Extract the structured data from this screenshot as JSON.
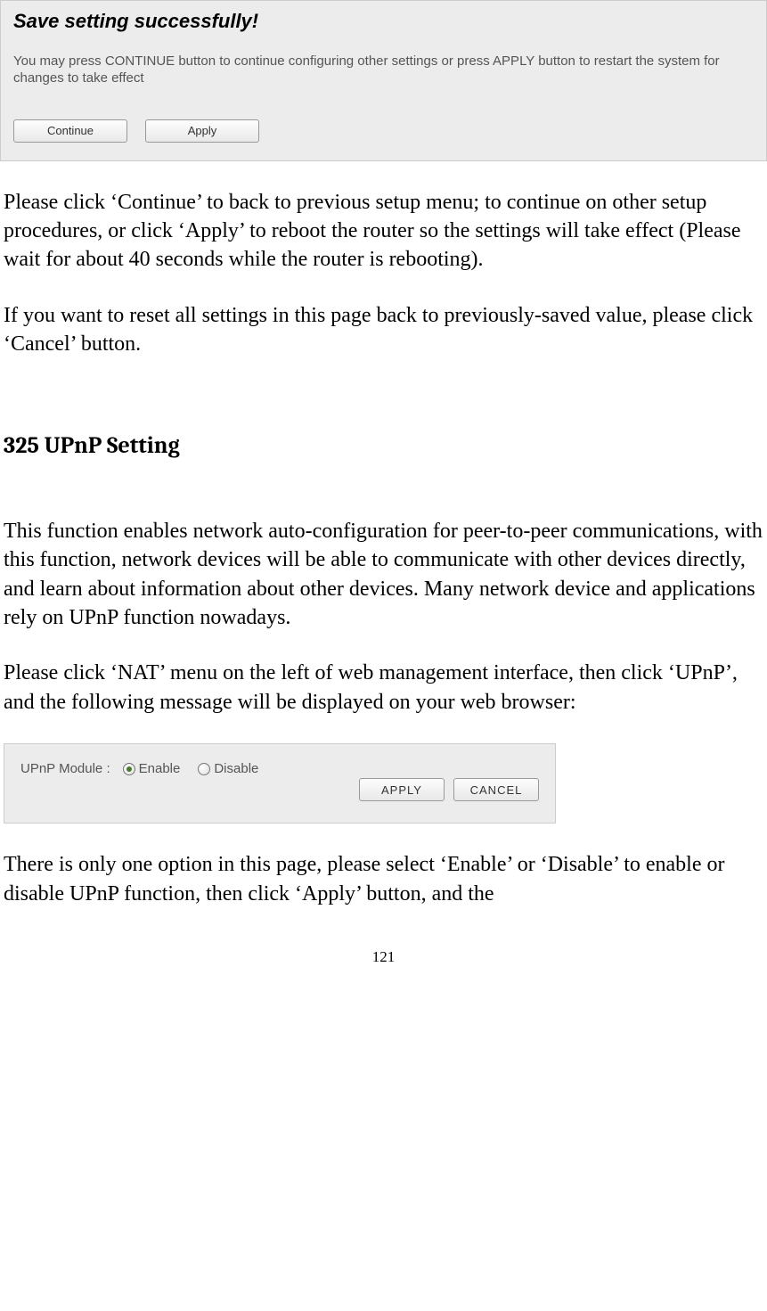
{
  "dialog1": {
    "heading": "Save setting successfully!",
    "description": "You may press CONTINUE button to continue configuring other settings or press APPLY button to restart the system for changes to take effect",
    "continue_label": "Continue",
    "apply_label": "Apply"
  },
  "body": {
    "para1": "Please click ‘Continue’ to back to previous setup menu; to continue on other setup procedures, or click ‘Apply’ to reboot the router so the settings will take effect (Please wait for about 40 seconds while the router is rebooting).",
    "para2": "If you want to reset all settings in this page back to previously-saved value, please click ‘Cancel’ button.",
    "section_heading": "3­2­5 UPnP Setting",
    "para3": "This function enables network auto-configuration for peer-to-peer communications, with this function, network devices will be able to communicate with other devices directly, and learn about information about other devices. Many network device and applications rely on UPnP function nowadays.",
    "para4": "Please click ‘NAT’ menu on the left of web management interface, then click ‘UPnP’, and the following message will be displayed on your web browser:",
    "para5": "There is only one option in this page, please select ‘Enable’ or ‘Disable’ to enable or disable UPnP function, then click ‘Apply’ button, and the"
  },
  "dialog2": {
    "label": "UPnP Module :",
    "enable_label": "Enable",
    "disable_label": "Disable",
    "apply_label": "APPLY",
    "cancel_label": "CANCEL"
  },
  "page_number": "121"
}
